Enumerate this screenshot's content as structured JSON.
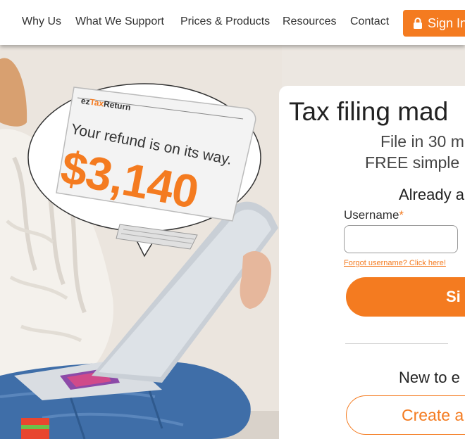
{
  "nav": {
    "links": [
      "Why Us",
      "What We Support",
      "Prices & Products",
      "Resources",
      "Contact"
    ],
    "signin_label": "Sign In"
  },
  "hero": {
    "bubble": {
      "logo_prefix": "ez",
      "logo_accent": "Tax",
      "logo_suffix": "Return",
      "message": "Your refund is on its way.",
      "amount": "$3,140"
    }
  },
  "card": {
    "title": "Tax filing mad",
    "subtitle_line1": "File in 30 m",
    "subtitle_line2": "FREE simple",
    "already": "Already a",
    "username_label": "Username",
    "username_required": "*",
    "username_value": "",
    "forgot_link": "Forgot username? Click here!",
    "signin_button": "Si",
    "new_to": "New to e",
    "create_button": "Create a"
  },
  "colors": {
    "accent": "#f47b20",
    "background": "#ece7e1"
  },
  "icons": {
    "signin": "lock-icon"
  }
}
